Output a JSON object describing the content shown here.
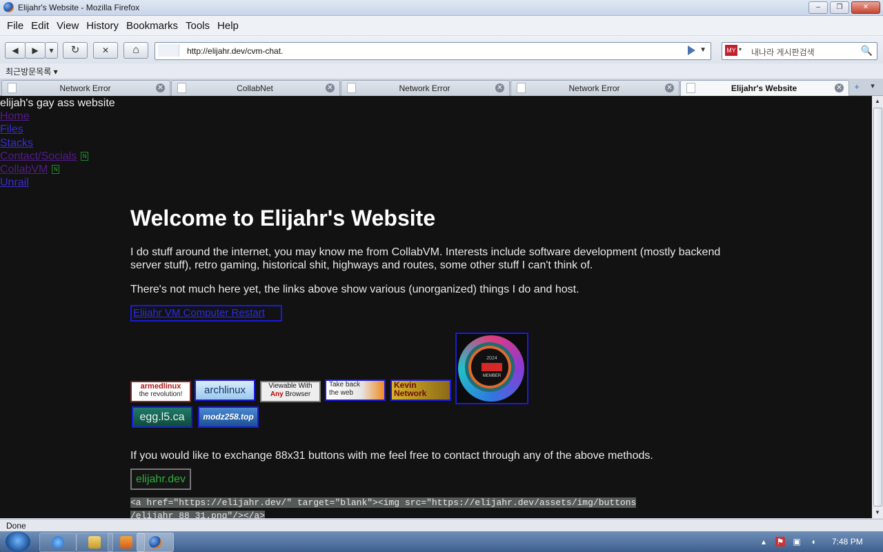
{
  "window": {
    "title": "Elijahr's Website - Mozilla Firefox",
    "minimize": "–",
    "restore": "❐",
    "close": "✕"
  },
  "menu": [
    "File",
    "Edit",
    "View",
    "History",
    "Bookmarks",
    "Tools",
    "Help"
  ],
  "nav": {
    "back": "◀",
    "forward": "▶",
    "history_dd": "▾",
    "reload": "↻",
    "stop": "✕",
    "home": "⌂"
  },
  "urlbar": {
    "url": "http://elijahr.dev/cvm-chat.",
    "dropdown": "▼"
  },
  "search": {
    "placeholder": "내나라 게시판검색",
    "engine_icon": "MY",
    "engine_dd": "▾",
    "search_icon": "🔍"
  },
  "bookmarks": {
    "item": "최근방문목록 ▾"
  },
  "tabs": [
    {
      "label": "Network Error",
      "close": "✕"
    },
    {
      "label": "CollabNet",
      "close": "✕"
    },
    {
      "label": "Network Error",
      "close": "✕"
    },
    {
      "label": "Network Error",
      "close": "✕"
    },
    {
      "label": "Elijahr's Website",
      "close": "✕",
      "active": true
    }
  ],
  "tabbar": {
    "new_tab": "+",
    "list": "▾"
  },
  "page": {
    "site_name": "elijah's gay ass website",
    "nav": [
      {
        "label": "Home",
        "visited": true
      },
      {
        "label": "Files",
        "visited": false
      },
      {
        "label": "Stacks",
        "visited": false
      },
      {
        "label": "Contact/Socials",
        "visited": true,
        "new": "N"
      },
      {
        "label": "CollabVM",
        "visited": true,
        "new": "N"
      },
      {
        "label": "Unrail",
        "visited": false
      }
    ],
    "heading": "Welcome to Elijahr's Website",
    "intro": "I do stuff around the internet, you may know me from CollabVM. Interests include software development (mostly backend server stuff), retro gaming, historical shit, highways and routes, some other stuff I can't think of.",
    "note": "There's not much here yet, the links above show various (unorganized) things I do and host.",
    "highlight_link": "Elijahr VM Computer Restart",
    "badges": {
      "armed": {
        "title": "armedlinux",
        "sub": "the revolution!"
      },
      "arch": "archlinux",
      "anybrowser": {
        "line1": "Viewable With",
        "line2a": "Any",
        "line2b": "Browser"
      },
      "takeback": {
        "line1": "Take back",
        "line2": "the web"
      },
      "kevin": {
        "line1": "Kevin",
        "line2": "Network"
      },
      "egg": "egg.l5.ca",
      "modz": "modz258.top",
      "eff": {
        "year": "2024",
        "member": "MEMBER"
      }
    },
    "exchange_text": "If you would like to exchange 88x31 buttons with me feel free to contact through any of the above methods.",
    "my_badge": "elijahr.dev",
    "code_line1": "<a href=\"https://elijahr.dev/\" target=\"blank\"><img src=\"https://elijahr.dev/assets/img/buttons",
    "code_line2": "/elijahr 88 31.png\"/></a>"
  },
  "status": {
    "text": "Done"
  },
  "taskbar": {
    "clock": "7:48 PM"
  },
  "colors": {
    "link": "#3a2bd1",
    "visited": "#551a8b",
    "background": "#121212",
    "badge_border": "#1b1bd8"
  }
}
